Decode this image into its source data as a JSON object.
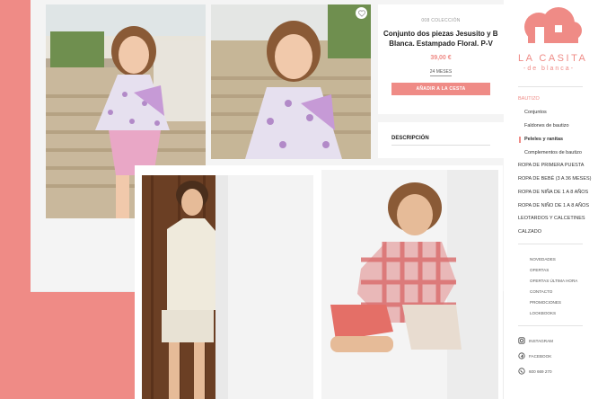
{
  "colors": {
    "accent": "#ef8b86"
  },
  "product": {
    "ref": "008 COLECCIÓN",
    "title_line1": "Conjunto dos piezas Jesusito y Bra",
    "title_line2": "Blanca. Estampado Floral. P-V",
    "price": "39,00 €",
    "size": "24 MESES",
    "cart_button": "AÑADIR A LA CESTA"
  },
  "description": {
    "label": "DESCRIPCIÓN"
  },
  "gallery": {
    "favorite_icon": "heart-icon"
  },
  "brand": {
    "name": "LA CASITA",
    "sub": "-de blanca-"
  },
  "nav": [
    {
      "label": "BAUTIZO",
      "kind": "section",
      "active": true
    },
    {
      "label": "Conjuntos",
      "kind": "sub"
    },
    {
      "label": "Faldones de bautizo",
      "kind": "sub"
    },
    {
      "label": "Peleles y ranitas",
      "kind": "sub",
      "selected": true
    },
    {
      "label": "Complementos de bautizo",
      "kind": "sub"
    },
    {
      "label": "ROPA DE PRIMERA PUESTA",
      "kind": "section"
    },
    {
      "label": "ROPA DE BEBÉ (3 A 36 MESES)",
      "kind": "section"
    },
    {
      "label": "ROPA DE NIÑA DE 1 A 8 AÑOS",
      "kind": "section"
    },
    {
      "label": "ROPA DE NIÑO DE 1 A 8 AÑOS",
      "kind": "section"
    },
    {
      "label": "LEOTARDOS Y CALCETINES",
      "kind": "section"
    },
    {
      "label": "CALZADO",
      "kind": "section"
    }
  ],
  "footer_links": [
    "NOVEDADES",
    "OFERTAS",
    "OFERTAS ÚLTIMA HORA",
    "CONTACTO",
    "PROMOCIONES",
    "LOOKBOOKS"
  ],
  "social": [
    {
      "icon": "instagram-icon",
      "label": "INSTAGRAM"
    },
    {
      "icon": "facebook-icon",
      "label": "FACEBOOK"
    },
    {
      "icon": "whatsapp-icon",
      "label": "600 669 270"
    }
  ]
}
